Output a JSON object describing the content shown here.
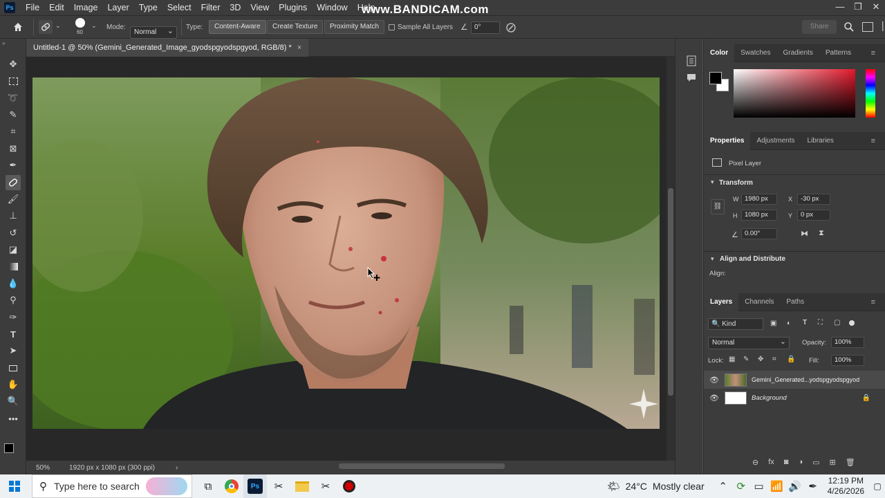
{
  "app": {
    "logo": "Ps",
    "watermark": "www.BANDICAM.com"
  },
  "menu": [
    "File",
    "Edit",
    "Image",
    "Layer",
    "Type",
    "Select",
    "Filter",
    "3D",
    "View",
    "Plugins",
    "Window",
    "Help"
  ],
  "window_buttons": {
    "minimize": "—",
    "restore": "❐",
    "close": "✕"
  },
  "options": {
    "brush_size": "60",
    "mode_label": "Mode:",
    "mode_value": "Normal",
    "type_label": "Type:",
    "type_buttons": [
      "Content-Aware",
      "Create Texture",
      "Proximity Match"
    ],
    "active_type": "Content-Aware",
    "sample_all_layers": "Sample All Layers",
    "angle_value": "0°",
    "share_label": "Share"
  },
  "document": {
    "tab_title": "Untitled-1 @ 50% (Gemini_Generated_Image_gyodspgyodspgyod, RGB/8) *",
    "close": "×",
    "zoom": "50%",
    "dimensions": "1920 px x 1080 px (300 ppi)"
  },
  "color_panel": {
    "tabs": [
      "Color",
      "Swatches",
      "Gradients",
      "Patterns"
    ],
    "active_tab": "Color",
    "foreground": "#000000",
    "background": "#ffffff"
  },
  "properties_panel": {
    "tabs": [
      "Properties",
      "Adjustments",
      "Libraries"
    ],
    "active_tab": "Properties",
    "layer_type": "Pixel Layer",
    "transform_title": "Transform",
    "w_label": "W",
    "w": "1980 px",
    "h_label": "H",
    "h": "1080 px",
    "x_label": "X",
    "x": "-30 px",
    "y_label": "Y",
    "y": "0 px",
    "angle": "0.00°",
    "align_title": "Align and Distribute",
    "align_label": "Align:"
  },
  "layers_panel": {
    "tabs": [
      "Layers",
      "Channels",
      "Paths"
    ],
    "active_tab": "Layers",
    "filter_kind": "Kind",
    "blend_mode": "Normal",
    "opacity_label": "Opacity:",
    "opacity": "100%",
    "lock_label": "Lock:",
    "fill_label": "Fill:",
    "fill": "100%",
    "layers": [
      {
        "name": "Gemini_Generated...yodspgyodspgyod",
        "selected": true
      },
      {
        "name": "Background",
        "selected": false
      }
    ]
  },
  "taskbar": {
    "search_placeholder": "Type here to search",
    "temperature": "24°C",
    "weather": "Mostly clear",
    "time": "12:19 PM",
    "date": "4/26/2026"
  }
}
